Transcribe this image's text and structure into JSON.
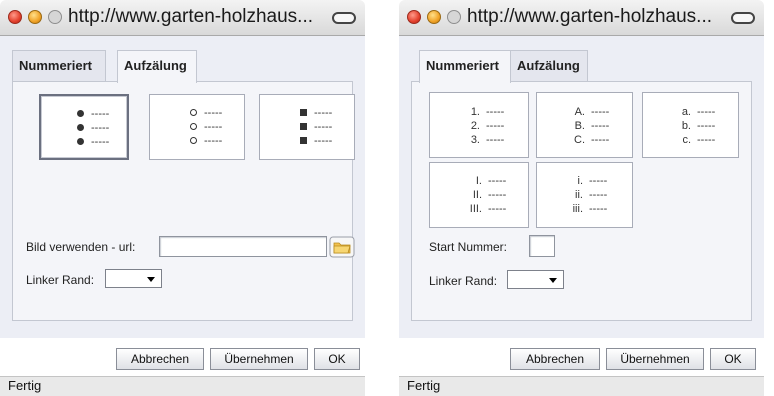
{
  "windows": [
    {
      "title_url": "http://www.garten-holzhaus...",
      "tabs": {
        "numbered": "Nummeriert",
        "bullets": "Aufzälung"
      },
      "active_tab": "bullets",
      "bullet_styles": [
        {
          "shape": "disc",
          "dashes": [
            "-----",
            "-----",
            "-----"
          ],
          "selected": true
        },
        {
          "shape": "circle",
          "dashes": [
            "-----",
            "-----",
            "-----"
          ],
          "selected": false
        },
        {
          "shape": "square",
          "dashes": [
            "-----",
            "-----",
            "-----"
          ],
          "selected": false
        }
      ],
      "image_url_label": "Bild verwenden - url:",
      "image_url_value": "",
      "left_margin_label": "Linker Rand:",
      "left_margin_value": "",
      "buttons": {
        "cancel": "Abbrechen",
        "apply": "Übernehmen",
        "ok": "OK"
      },
      "status": "Fertig"
    },
    {
      "title_url": "http://www.garten-holzhaus...",
      "tabs": {
        "numbered": "Nummeriert",
        "bullets": "Aufzälung"
      },
      "active_tab": "numbered",
      "number_styles": [
        {
          "markers": [
            "1.",
            "2.",
            "3."
          ],
          "dashes": [
            "-----",
            "-----",
            "-----"
          ]
        },
        {
          "markers": [
            "A.",
            "B.",
            "C."
          ],
          "dashes": [
            "-----",
            "-----",
            "-----"
          ]
        },
        {
          "markers": [
            "a.",
            "b.",
            "c."
          ],
          "dashes": [
            "-----",
            "-----",
            "-----"
          ]
        },
        {
          "markers": [
            "I.",
            "II.",
            "III."
          ],
          "dashes": [
            "-----",
            "-----",
            "-----"
          ]
        },
        {
          "markers": [
            "i.",
            "ii.",
            "iii."
          ],
          "dashes": [
            "-----",
            "-----",
            "-----"
          ]
        }
      ],
      "start_number_label": "Start Nummer:",
      "start_number_value": "",
      "left_margin_label": "Linker Rand:",
      "left_margin_value": "",
      "buttons": {
        "cancel": "Abbrechen",
        "apply": "Übernehmen",
        "ok": "OK"
      },
      "status": "Fertig"
    }
  ],
  "colors": {
    "dialog_bg": "#eceef5",
    "panel_border": "#c3c7d1",
    "close_light": "#e3402c",
    "minimize_light": "#f0a226",
    "zoom_light": "#d6d6d6",
    "folder_icon": "#f2c14e"
  }
}
